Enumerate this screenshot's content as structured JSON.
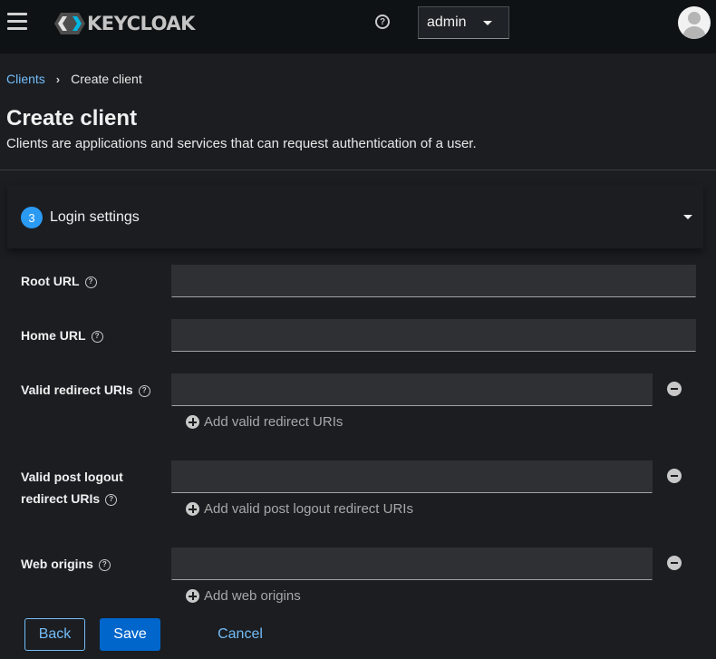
{
  "header": {
    "brand": "KEYCLOAK",
    "help_icon": "question-circle-icon",
    "realm_select": {
      "value": "admin"
    },
    "menu_icon": "hamburger-icon",
    "avatar_icon": "user-avatar-icon"
  },
  "breadcrumb": {
    "parent": "Clients",
    "current": "Create client"
  },
  "page": {
    "title": "Create client",
    "description": "Clients are applications and services that can request authentication of a user."
  },
  "section": {
    "step": "3",
    "title": "Login settings"
  },
  "form": {
    "root_url": {
      "label": "Root URL",
      "value": ""
    },
    "home_url": {
      "label": "Home URL",
      "value": ""
    },
    "valid_redirect_uris": {
      "label": "Valid redirect URIs",
      "value": "",
      "add_label": "Add valid redirect URIs"
    },
    "valid_post_logout": {
      "label_line1": "Valid post logout",
      "label_line2": "redirect URIs",
      "value": "",
      "add_label": "Add valid post logout redirect URIs"
    },
    "web_origins": {
      "label": "Web origins",
      "value": "",
      "add_label": "Add web origins"
    }
  },
  "actions": {
    "back": "Back",
    "save": "Save",
    "cancel": "Cancel"
  },
  "colors": {
    "accent": "#0066cc",
    "link": "#73bcf7",
    "badge": "#2b9af3",
    "background": "#1b1d21",
    "masthead": "#0f1214"
  }
}
